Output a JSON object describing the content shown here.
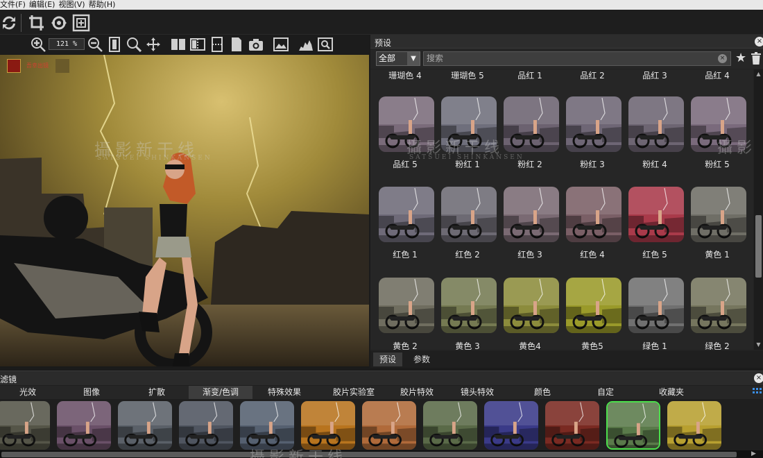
{
  "menu": [
    "文件(F)",
    "编辑(E)",
    "视图(V)",
    "帮助(H)"
  ],
  "zoom": "121 %",
  "watermark": {
    "cn": "攝影新干线",
    "en": "SATSUEI SHINKANSEN"
  },
  "stamp": "吾幸出镜",
  "preset_panel": {
    "title": "预设",
    "close": "×",
    "category": "全部",
    "search_placeholder": "搜索",
    "labels_row0": [
      "珊瑚色 4",
      "珊瑚色 5",
      "品红 1",
      "品红 2",
      "品红 3",
      "品红 4"
    ],
    "labels_row1": [
      "品红 5",
      "粉红 1",
      "粉红 2",
      "粉红 3",
      "粉红 4",
      "粉红 5"
    ],
    "labels_row2": [
      "红色 1",
      "红色 2",
      "红色 3",
      "红色 4",
      "红色 5",
      "黄色 1"
    ],
    "labels_row3": [
      "黄色 2",
      "黄色 3",
      "黄色4",
      "黄色5",
      "绿色 1",
      "绿色 2"
    ],
    "tabs": [
      "预设",
      "参数"
    ]
  },
  "filter_panel": {
    "title": "滤镜",
    "close": "×",
    "categories": [
      "光效",
      "图像",
      "扩散",
      "渐变/色调",
      "特殊效果",
      "胶片实验室",
      "胶片特效",
      "镜头特效",
      "颜色",
      "自定",
      "收藏夹"
    ],
    "active_category": "渐变/色调"
  },
  "colors": {
    "preset_tints": [
      [
        "#7a6b7a",
        "#6f6f7c",
        "#6c6270",
        "#6e6675",
        "#6d6572",
        "#7a6a7c"
      ],
      [
        "#6e6a78",
        "#6d6a73",
        "#7a6a73",
        "#7a5f66",
        "#a93a4a",
        "#6f6e66"
      ],
      [
        "#6f6d5f",
        "#757a52",
        "#8c8c3c",
        "#9a9a2a",
        "#707070",
        "#76765e"
      ]
    ],
    "filter_tints": [
      "#555548",
      "#6a5068",
      "#5a6068",
      "#4f5560",
      "#556070",
      "#b8741e",
      "#b06a3a",
      "#5a6a48",
      "#3a3a88",
      "#7a2a22",
      "#5a7a4a",
      "#b8a030"
    ],
    "selected_border": "#4ce04c"
  }
}
